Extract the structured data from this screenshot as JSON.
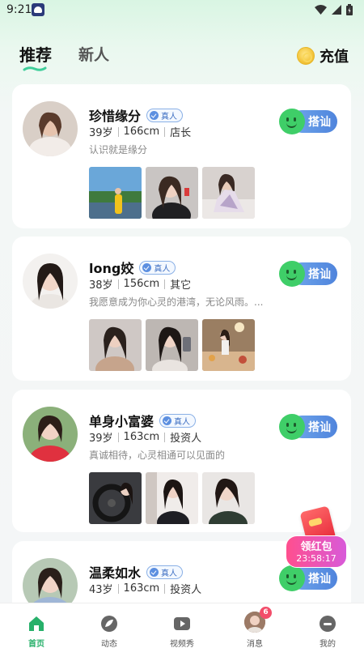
{
  "status": {
    "time": "9:21"
  },
  "header": {
    "tabs": [
      {
        "label": "推荐",
        "active": true
      },
      {
        "label": "新人",
        "active": false
      }
    ],
    "recharge_label": "充值"
  },
  "badge_label": "真人",
  "chat_label": "搭讪",
  "profiles": [
    {
      "name": "珍惜缘分",
      "age": "39岁",
      "height": "166cm",
      "job": "店长",
      "bio": "认识就是缘分"
    },
    {
      "name": "long姣",
      "age": "38岁",
      "height": "156cm",
      "job": "其它",
      "bio": "我愿意成为你心灵的港湾，无论风雨。..."
    },
    {
      "name": "单身小富婆",
      "age": "39岁",
      "height": "163cm",
      "job": "投资人",
      "bio": "真诚相待，心灵相通可以见面的"
    },
    {
      "name": "温柔如水",
      "age": "43岁",
      "height": "163cm",
      "job": "投资人",
      "bio": ""
    }
  ],
  "red_packet": {
    "title": "领红包",
    "timer": "23:58:17"
  },
  "nav": {
    "items": [
      {
        "label": "首页",
        "active": true
      },
      {
        "label": "动态",
        "active": false
      },
      {
        "label": "视频秀",
        "active": false
      },
      {
        "label": "消息",
        "active": false,
        "badge": "6"
      },
      {
        "label": "我的",
        "active": false
      }
    ]
  },
  "colors": {
    "accent": "#27b06a",
    "chat_button": "#5b8fe0",
    "badge": "#f24d6a"
  }
}
